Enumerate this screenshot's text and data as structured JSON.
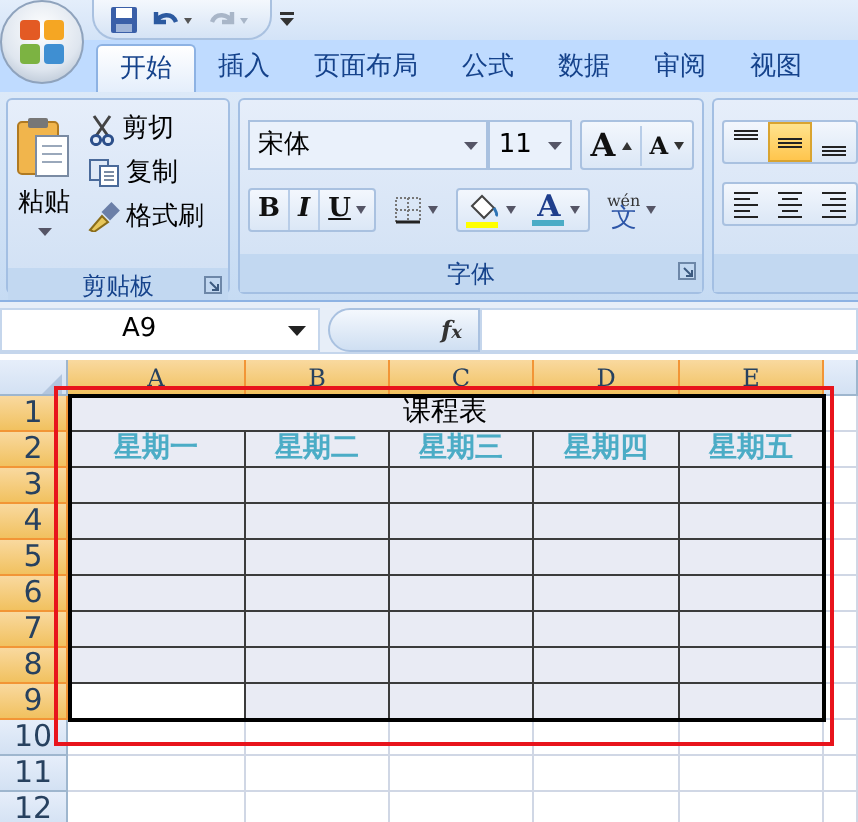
{
  "tabs": [
    {
      "label": "开始",
      "selected": true
    },
    {
      "label": "插入",
      "selected": false
    },
    {
      "label": "页面布局",
      "selected": false
    },
    {
      "label": "公式",
      "selected": false
    },
    {
      "label": "数据",
      "selected": false
    },
    {
      "label": "审阅",
      "selected": false
    },
    {
      "label": "视图",
      "selected": false
    }
  ],
  "clipboard": {
    "paste": "粘贴",
    "cut": "剪切",
    "copy": "复制",
    "format_painter": "格式刷",
    "label": "剪贴板"
  },
  "font": {
    "name": "宋体",
    "size": "11",
    "label": "字体",
    "grow": "A",
    "shrink": "A",
    "bold": "B",
    "italic": "I",
    "underline": "U",
    "font_color": "A",
    "phonetic_top": "wén",
    "phonetic": "文"
  },
  "alignment": {
    "vertical": [
      {
        "kind": "top",
        "selected": false
      },
      {
        "kind": "middle",
        "selected": true
      },
      {
        "kind": "bottom",
        "selected": false
      }
    ],
    "horizontal": [
      {
        "kind": "left",
        "selected": false
      },
      {
        "kind": "center",
        "selected": false
      },
      {
        "kind": "right",
        "selected": false
      }
    ]
  },
  "formula_bar": {
    "name_box": "A9",
    "fx": "f$_{x}$"
  },
  "sheet": {
    "columns": [
      {
        "label": "A",
        "selected": true
      },
      {
        "label": "B",
        "selected": true
      },
      {
        "label": "C",
        "selected": true
      },
      {
        "label": "D",
        "selected": true
      },
      {
        "label": "E",
        "selected": true
      }
    ],
    "rows": [
      {
        "label": "1",
        "selected": true,
        "cells": [
          {
            "kind": "title",
            "text": "课程表"
          }
        ]
      },
      {
        "label": "2",
        "selected": true,
        "cells": [
          {
            "kind": "heading",
            "text": "星期一"
          },
          {
            "kind": "heading",
            "text": "星期二"
          },
          {
            "kind": "heading",
            "text": "星期三"
          },
          {
            "kind": "heading",
            "text": "星期四"
          },
          {
            "kind": "heading",
            "text": "星期五"
          }
        ]
      },
      {
        "label": "3",
        "selected": true,
        "cells": [
          {
            "kind": "empty",
            "active": false
          },
          {
            "kind": "empty",
            "active": false
          },
          {
            "kind": "empty",
            "active": false
          },
          {
            "kind": "empty",
            "active": false
          },
          {
            "kind": "empty",
            "active": false
          }
        ]
      },
      {
        "label": "4",
        "selected": true,
        "cells": [
          {
            "kind": "empty",
            "active": false
          },
          {
            "kind": "empty",
            "active": false
          },
          {
            "kind": "empty",
            "active": false
          },
          {
            "kind": "empty",
            "active": false
          },
          {
            "kind": "empty",
            "active": false
          }
        ]
      },
      {
        "label": "5",
        "selected": true,
        "cells": [
          {
            "kind": "empty",
            "active": false
          },
          {
            "kind": "empty",
            "active": false
          },
          {
            "kind": "empty",
            "active": false
          },
          {
            "kind": "empty",
            "active": false
          },
          {
            "kind": "empty",
            "active": false
          }
        ]
      },
      {
        "label": "6",
        "selected": true,
        "cells": [
          {
            "kind": "empty",
            "active": false
          },
          {
            "kind": "empty",
            "active": false
          },
          {
            "kind": "empty",
            "active": false
          },
          {
            "kind": "empty",
            "active": false
          },
          {
            "kind": "empty",
            "active": false
          }
        ]
      },
      {
        "label": "7",
        "selected": true,
        "cells": [
          {
            "kind": "empty",
            "active": false
          },
          {
            "kind": "empty",
            "active": false
          },
          {
            "kind": "empty",
            "active": false
          },
          {
            "kind": "empty",
            "active": false
          },
          {
            "kind": "empty",
            "active": false
          }
        ]
      },
      {
        "label": "8",
        "selected": true,
        "cells": [
          {
            "kind": "empty",
            "active": false
          },
          {
            "kind": "empty",
            "active": false
          },
          {
            "kind": "empty",
            "active": false
          },
          {
            "kind": "empty",
            "active": false
          },
          {
            "kind": "empty",
            "active": false
          }
        ]
      },
      {
        "label": "9",
        "selected": true,
        "cells": [
          {
            "kind": "empty",
            "active": true
          },
          {
            "kind": "empty",
            "active": false
          },
          {
            "kind": "empty",
            "active": false
          },
          {
            "kind": "empty",
            "active": false
          },
          {
            "kind": "empty",
            "active": false
          }
        ]
      },
      {
        "label": "10",
        "selected": false
      },
      {
        "label": "11",
        "selected": false
      },
      {
        "label": "12",
        "selected": false
      }
    ]
  }
}
